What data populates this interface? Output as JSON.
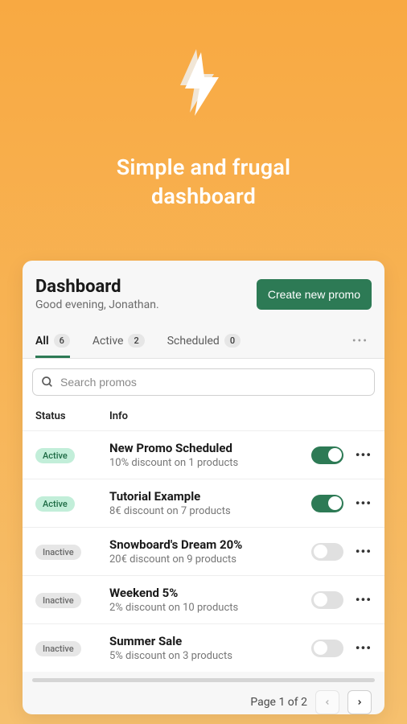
{
  "hero": {
    "headline_line1": "Simple and frugal",
    "headline_line2": "dashboard"
  },
  "dashboard": {
    "title": "Dashboard",
    "greeting": "Good evening, Jonathan.",
    "create_button": "Create new promo"
  },
  "tabs": [
    {
      "label": "All",
      "count": "6",
      "active": true
    },
    {
      "label": "Active",
      "count": "2",
      "active": false
    },
    {
      "label": "Scheduled",
      "count": "0",
      "active": false
    }
  ],
  "search": {
    "placeholder": "Search promos"
  },
  "table": {
    "headers": {
      "status": "Status",
      "info": "Info"
    },
    "rows": [
      {
        "status": "Active",
        "status_class": "active",
        "title": "New Promo Scheduled",
        "subtitle": "10% discount on 1 products",
        "enabled": true
      },
      {
        "status": "Active",
        "status_class": "active",
        "title": "Tutorial Example",
        "subtitle": "8€ discount on 7 products",
        "enabled": true
      },
      {
        "status": "Inactive",
        "status_class": "inactive",
        "title": "Snowboard's Dream 20%",
        "subtitle": "20€ discount on 9 products",
        "enabled": false
      },
      {
        "status": "Inactive",
        "status_class": "inactive",
        "title": "Weekend 5%",
        "subtitle": "2% discount on 10 products",
        "enabled": false
      },
      {
        "status": "Inactive",
        "status_class": "inactive",
        "title": "Summer Sale",
        "subtitle": "5% discount on 3 products",
        "enabled": false
      }
    ]
  },
  "pagination": {
    "label": "Page 1 of 2"
  }
}
